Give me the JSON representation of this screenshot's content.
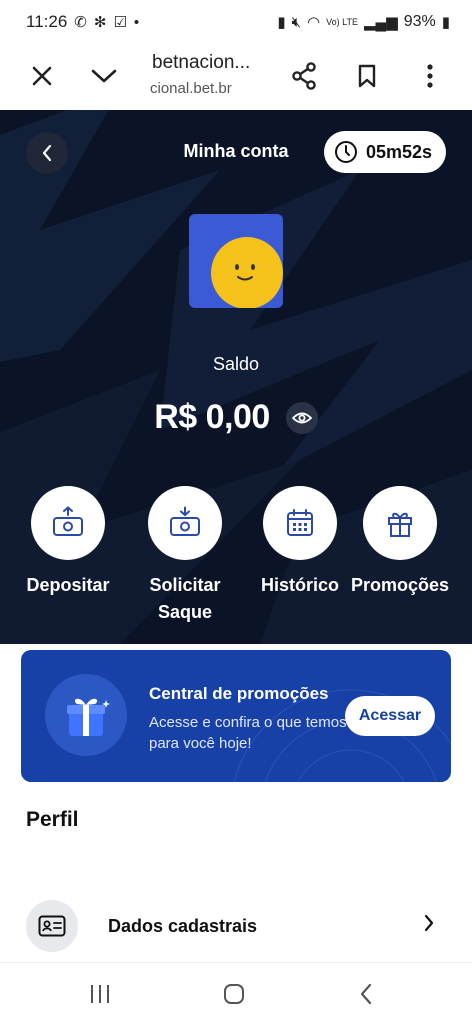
{
  "status_bar": {
    "time": "11:26",
    "battery": "93%",
    "network": "Vo) LTE"
  },
  "browser": {
    "title": "betnacion...",
    "host": "cional.bet.br"
  },
  "account": {
    "title": "Minha conta",
    "timer": "05m52s",
    "balance_label": "Saldo",
    "balance_value": "R$ 0,00"
  },
  "actions": [
    {
      "label": "Depositar",
      "icon": "deposit-icon"
    },
    {
      "label": "Solicitar Saque",
      "icon": "withdraw-icon"
    },
    {
      "label": "Histórico",
      "icon": "calendar-icon"
    },
    {
      "label": "Promoções",
      "icon": "gift-icon"
    }
  ],
  "promo": {
    "title": "Central de promoções",
    "subtitle": "Acesse e confira o que temos para você hoje!",
    "button": "Acessar"
  },
  "profile": {
    "section_title": "Perfil",
    "items": [
      {
        "label": "Dados cadastrais",
        "icon": "id-card-icon"
      }
    ]
  },
  "colors": {
    "hero_bg": "#0b1426",
    "promo_bg": "#1841a8",
    "avatar_bg": "#3b5bd6",
    "avatar_face": "#f5c21b"
  }
}
